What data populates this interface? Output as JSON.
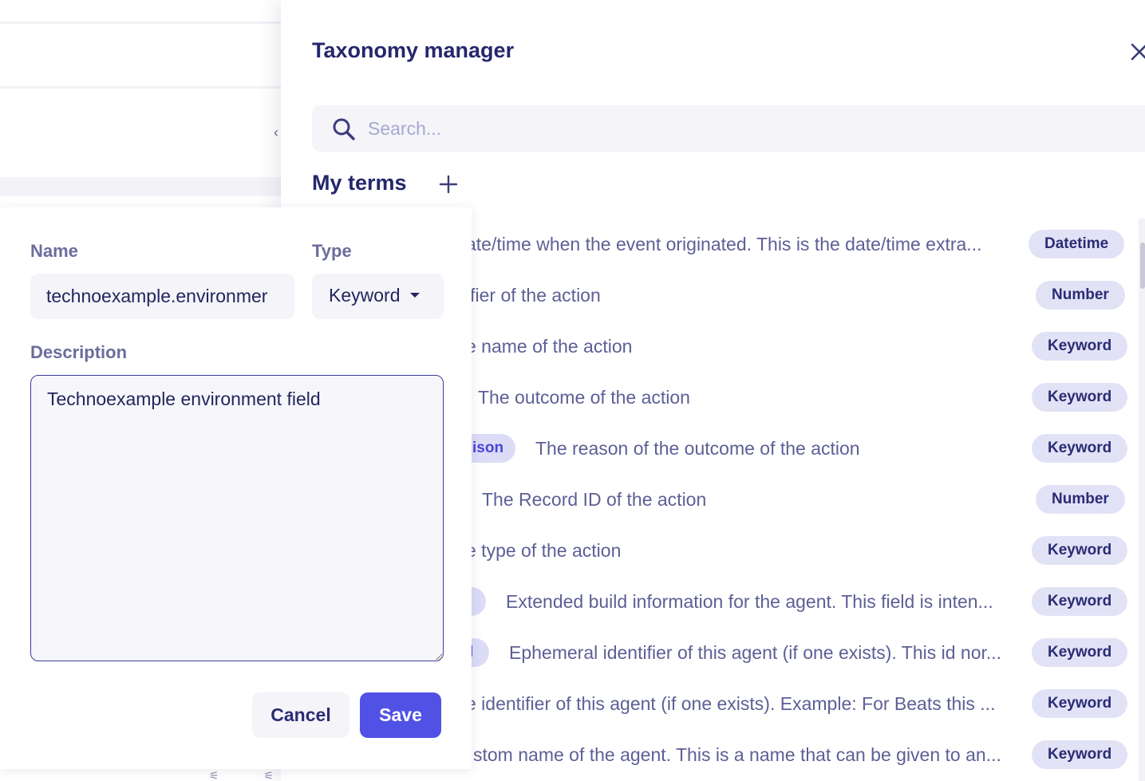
{
  "colors": {
    "accent": "#5052e6",
    "title_text": "#24276b",
    "muted_text": "#5d5f95",
    "badge_bg": "#e2e2f6",
    "pill_bg": "#dcdcf7",
    "pill_text": "#4a47d8"
  },
  "panel": {
    "title": "Taxonomy manager",
    "close_icon": "close-icon",
    "search": {
      "placeholder": "Search...",
      "value": "",
      "icon": "search-icon"
    },
    "section_title": "My terms",
    "add_icon": "plus-icon",
    "terms": [
      {
        "name": "",
        "description": "ate/time when the event originated. This is the date/time extra...",
        "type": "Datetime"
      },
      {
        "name": "",
        "description": "ifier of the action",
        "type": "Number"
      },
      {
        "name": "",
        "description": "e name of the action",
        "type": "Keyword"
      },
      {
        "name": "",
        "description": "The outcome of the action",
        "type": "Keyword"
      },
      {
        "name": "ison",
        "description": "The reason of the outcome of the action",
        "type": "Keyword"
      },
      {
        "name": "",
        "description": "The Record ID of the action",
        "type": "Number"
      },
      {
        "name": "",
        "description": "e type of the action",
        "type": "Keyword"
      },
      {
        "name": "",
        "description": "Extended build information for the agent. This field is inten...",
        "type": "Keyword"
      },
      {
        "name": "l",
        "description": "Ephemeral identifier of this agent (if one exists). This id nor...",
        "type": "Keyword"
      },
      {
        "name": "",
        "description": "e identifier of this agent (if one exists). Example: For Beats this ...",
        "type": "Keyword"
      },
      {
        "name": "",
        "description": "stom name of the agent. This is a name that can be given to an...",
        "type": "Keyword"
      }
    ]
  },
  "edit_form": {
    "name_label": "Name",
    "name_value": "technoexample.environmer",
    "type_label": "Type",
    "type_value": "Keyword",
    "description_label": "Description",
    "description_value": "Technoexample environment field",
    "cancel_label": "Cancel",
    "save_label": "Save"
  }
}
